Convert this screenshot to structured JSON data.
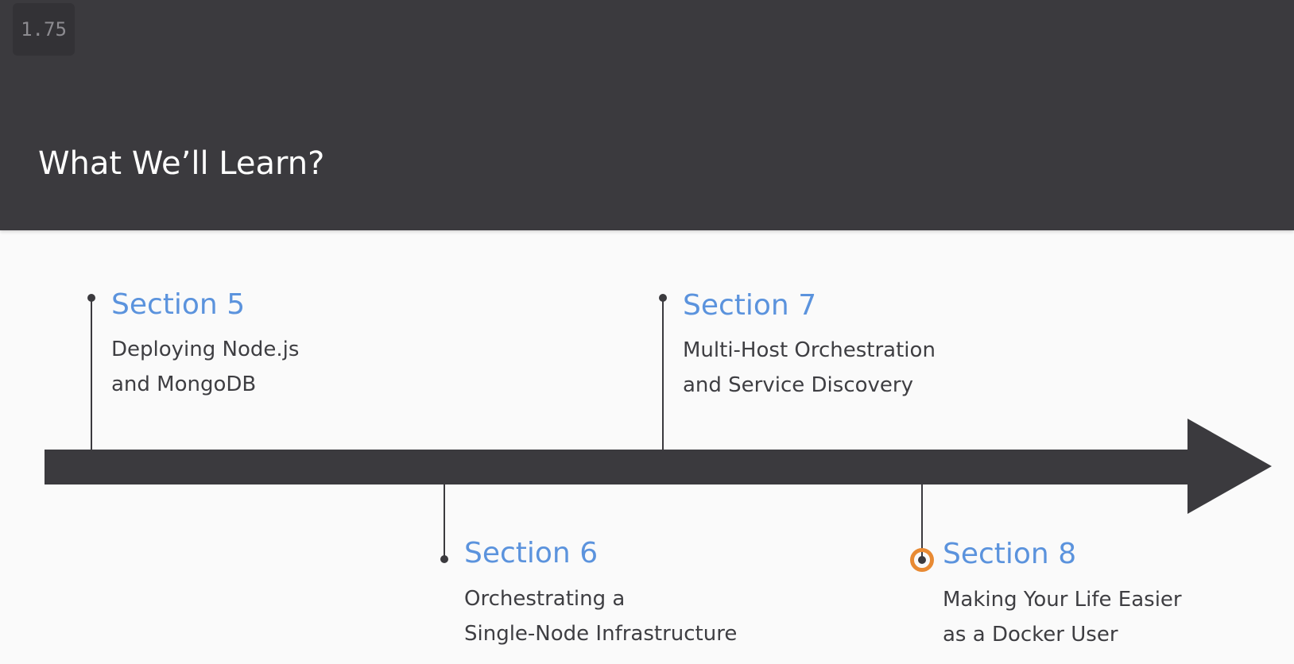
{
  "player": {
    "speed": "1.75"
  },
  "slide": {
    "title": "What We’ll Learn?",
    "sections": [
      {
        "heading": "Section 5",
        "lines": [
          "Deploying Node.js",
          "and MongoDB"
        ]
      },
      {
        "heading": "Section 6",
        "lines": [
          "Orchestrating a",
          "Single-Node Infrastructure"
        ]
      },
      {
        "heading": "Section 7",
        "lines": [
          "Multi-Host Orchestration",
          "and Service Discovery"
        ]
      },
      {
        "heading": "Section 8",
        "lines": [
          "Making Your Life Easier",
          "as a Docker User"
        ]
      }
    ]
  },
  "colors": {
    "header_bg": "#3b3a3e",
    "heading": "#5b93dd",
    "highlight": "#e88a33"
  }
}
